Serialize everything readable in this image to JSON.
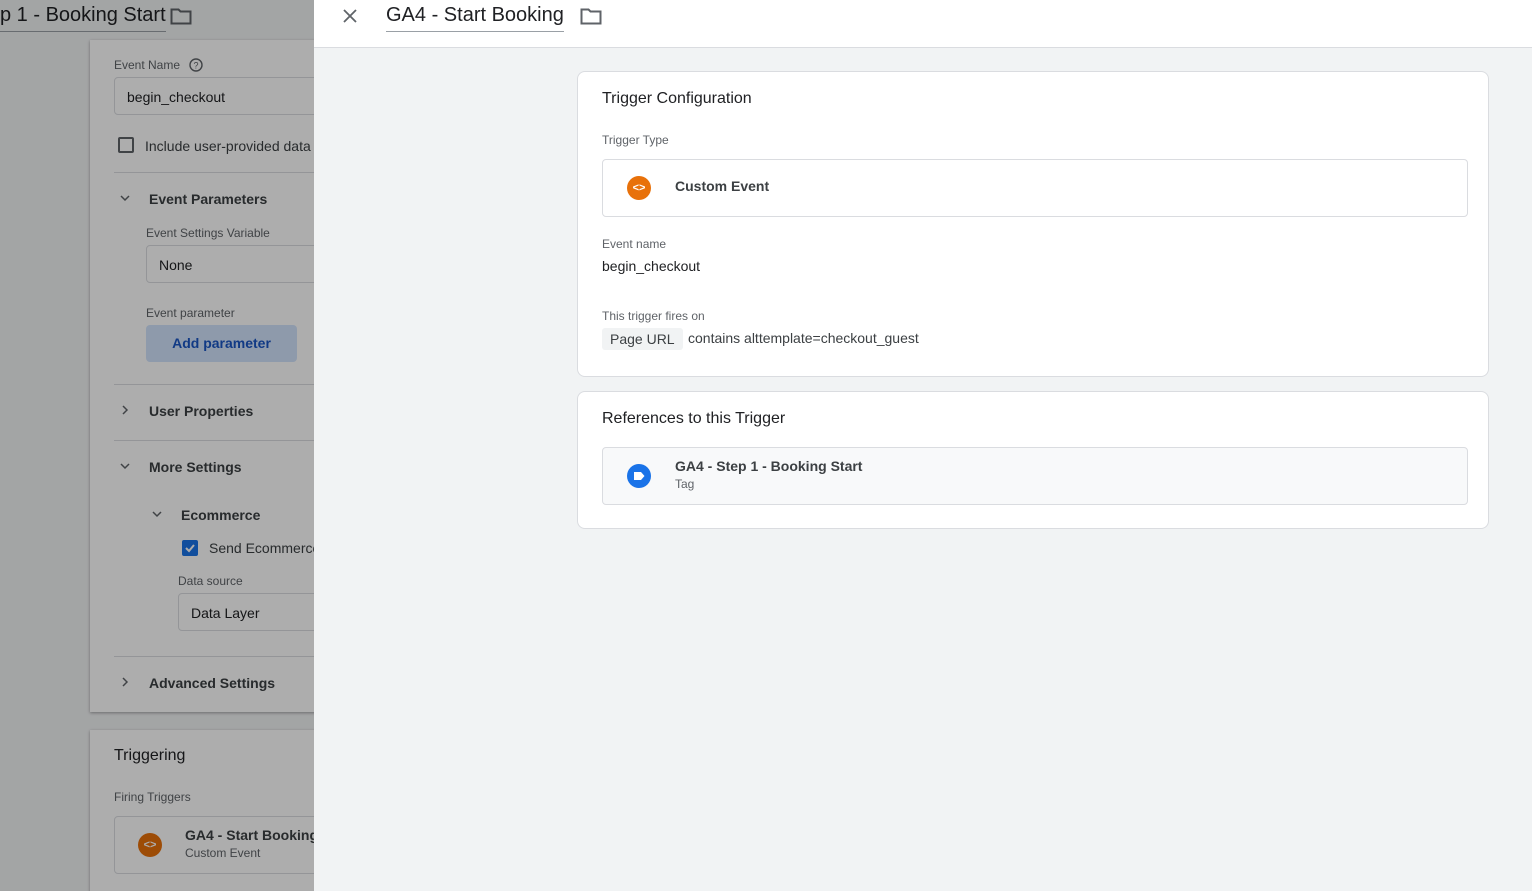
{
  "background": {
    "title": "p 1 - Booking Start",
    "event_name_label": "Event Name",
    "event_name_value": "begin_checkout",
    "include_user_data_label": "Include user-provided data",
    "event_parameters_label": "Event Parameters",
    "event_settings_variable_label": "Event Settings Variable",
    "event_settings_variable_value": "None",
    "event_parameter_label": "Event parameter",
    "add_parameter_label": "Add parameter",
    "user_properties_label": "User Properties",
    "more_settings_label": "More Settings",
    "ecommerce_label": "Ecommerce",
    "send_ecommerce_label": "Send Ecommerce",
    "data_source_label": "Data source",
    "data_source_value": "Data Layer",
    "advanced_settings_label": "Advanced Settings",
    "triggering_title": "Triggering",
    "firing_triggers_label": "Firing Triggers",
    "firing_trigger_name": "GA4 - Start Booking",
    "firing_trigger_type": "Custom Event"
  },
  "panel": {
    "title": "GA4 - Start Booking",
    "trigger_config": {
      "title": "Trigger Configuration",
      "trigger_type_label": "Trigger Type",
      "trigger_type_value": "Custom Event",
      "event_name_label": "Event name",
      "event_name_value": "begin_checkout",
      "fires_on_label": "This trigger fires on",
      "condition_variable": "Page URL",
      "condition_text": "contains alttemplate=checkout_guest"
    },
    "references": {
      "title": "References to this Trigger",
      "item_name": "GA4 - Step 1 - Booking Start",
      "item_type": "Tag"
    }
  },
  "colors": {
    "custom_event_orange": "#e8710a",
    "tag_blue": "#1a73e8",
    "panel_bg": "#f1f3f4"
  },
  "icons": [
    "close-icon",
    "folder-icon",
    "custom-event-icon",
    "tag-icon",
    "help-icon",
    "chevron-down-icon",
    "chevron-right-icon",
    "checkbox-checked-icon"
  ]
}
